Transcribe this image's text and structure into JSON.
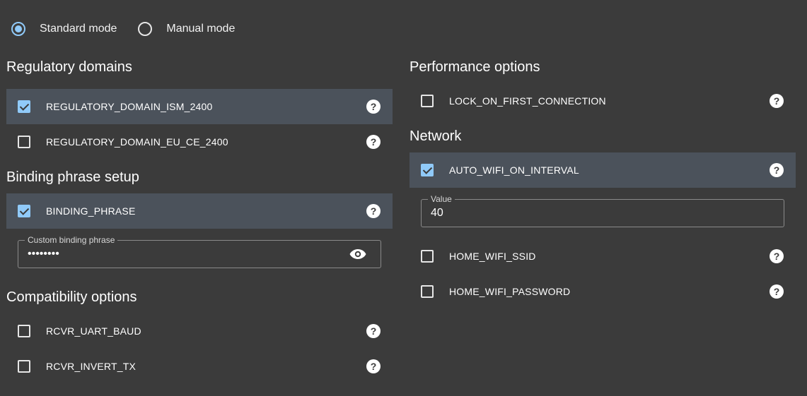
{
  "mode": {
    "standard_label": "Standard mode",
    "manual_label": "Manual mode",
    "selected": "standard"
  },
  "left": {
    "regulatory": {
      "heading": "Regulatory domains",
      "items": [
        {
          "label": "REGULATORY_DOMAIN_ISM_2400",
          "checked": true
        },
        {
          "label": "REGULATORY_DOMAIN_EU_CE_2400",
          "checked": false
        }
      ]
    },
    "binding": {
      "heading": "Binding phrase setup",
      "items": [
        {
          "label": "BINDING_PHRASE",
          "checked": true
        }
      ],
      "field_label": "Custom binding phrase",
      "field_value": "••••••••",
      "toggle_icon": "eye-icon"
    },
    "compat": {
      "heading": "Compatibility options",
      "items": [
        {
          "label": "RCVR_UART_BAUD",
          "checked": false
        },
        {
          "label": "RCVR_INVERT_TX",
          "checked": false
        }
      ]
    }
  },
  "right": {
    "performance": {
      "heading": "Performance options",
      "items": [
        {
          "label": "LOCK_ON_FIRST_CONNECTION",
          "checked": false
        }
      ]
    },
    "network": {
      "heading": "Network",
      "items": [
        {
          "label": "AUTO_WIFI_ON_INTERVAL",
          "checked": true
        },
        {
          "label": "HOME_WIFI_SSID",
          "checked": false
        },
        {
          "label": "HOME_WIFI_PASSWORD",
          "checked": false
        }
      ],
      "value_label": "Value",
      "value": "40"
    }
  },
  "help_glyph": "?",
  "colors": {
    "background": "#3b3b3b",
    "selected_row": "#4b525b",
    "accent": "#90caf9"
  }
}
